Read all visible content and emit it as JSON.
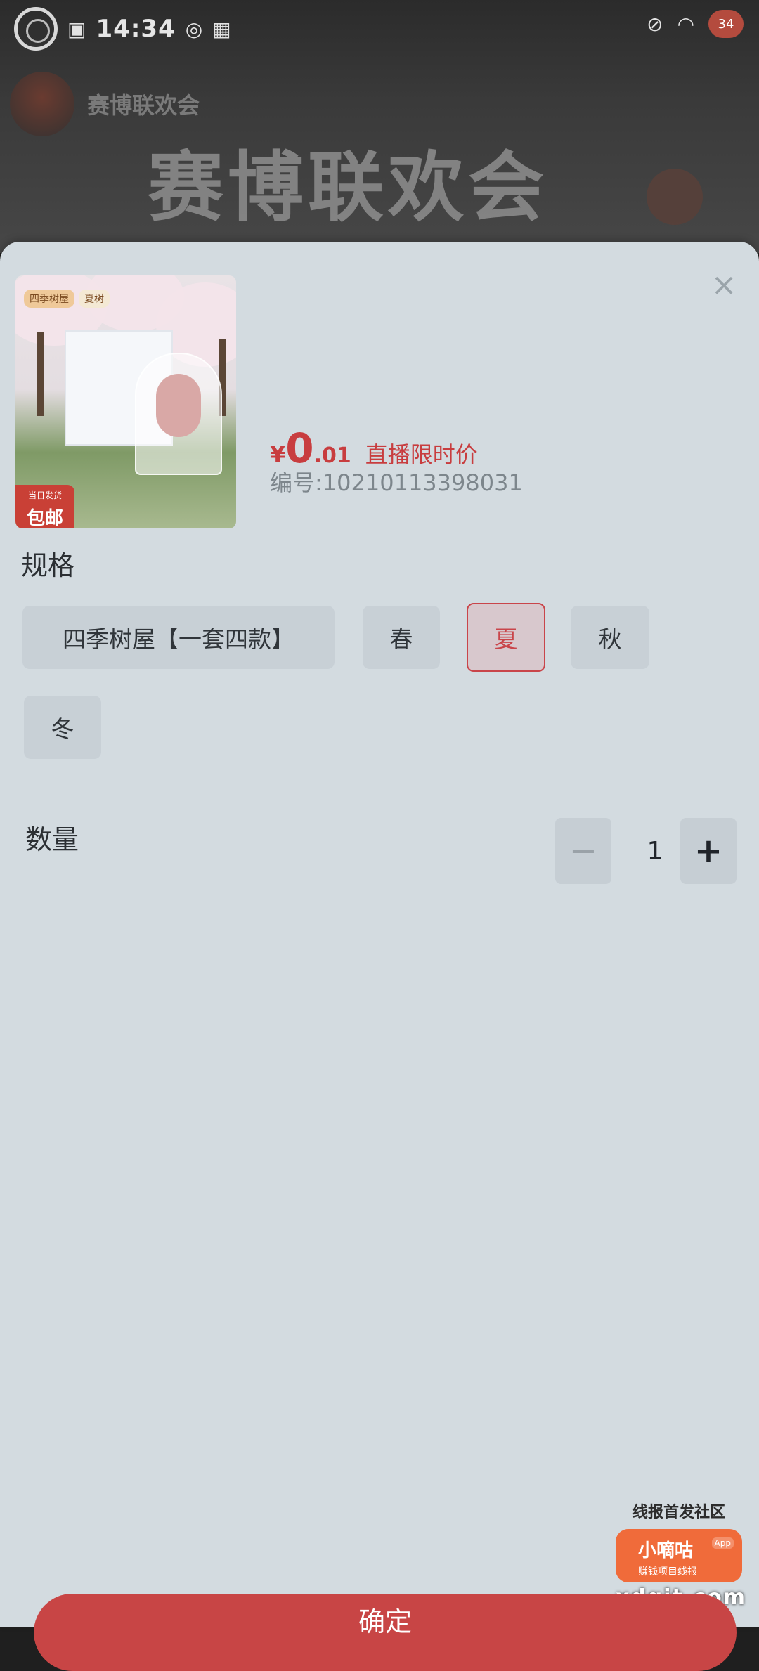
{
  "status_bar": {
    "time": "14:34",
    "battery": "34"
  },
  "background": {
    "host_name": "赛博联欢会",
    "live_title": "赛博联欢会"
  },
  "product": {
    "image_tags": [
      "四季树屋",
      "夏树"
    ],
    "badge_small": "当日发货",
    "badge_big": "包邮",
    "price_symbol": "¥",
    "price_integer": "0",
    "price_decimal": ".01",
    "price_label": "直播限时价",
    "code": "编号:10210113398031"
  },
  "spec": {
    "title": "规格",
    "options": [
      {
        "label": "四季树屋【一套四款】",
        "selected": false
      },
      {
        "label": "春",
        "selected": false
      },
      {
        "label": "夏",
        "selected": true
      },
      {
        "label": "秋",
        "selected": false
      },
      {
        "label": "冬",
        "selected": false
      }
    ]
  },
  "quantity": {
    "title": "数量",
    "value": "1",
    "minus": "−",
    "plus": "+"
  },
  "confirm_label": "确定",
  "watermark": {
    "top": "线报首发社区",
    "name": "小嘀咕",
    "app": "App",
    "sub": "赚钱项目线报",
    "domain": "xdgit.com"
  },
  "colors": {
    "accent": "#c83d3f",
    "sheet_bg": "#d3dbe0"
  }
}
